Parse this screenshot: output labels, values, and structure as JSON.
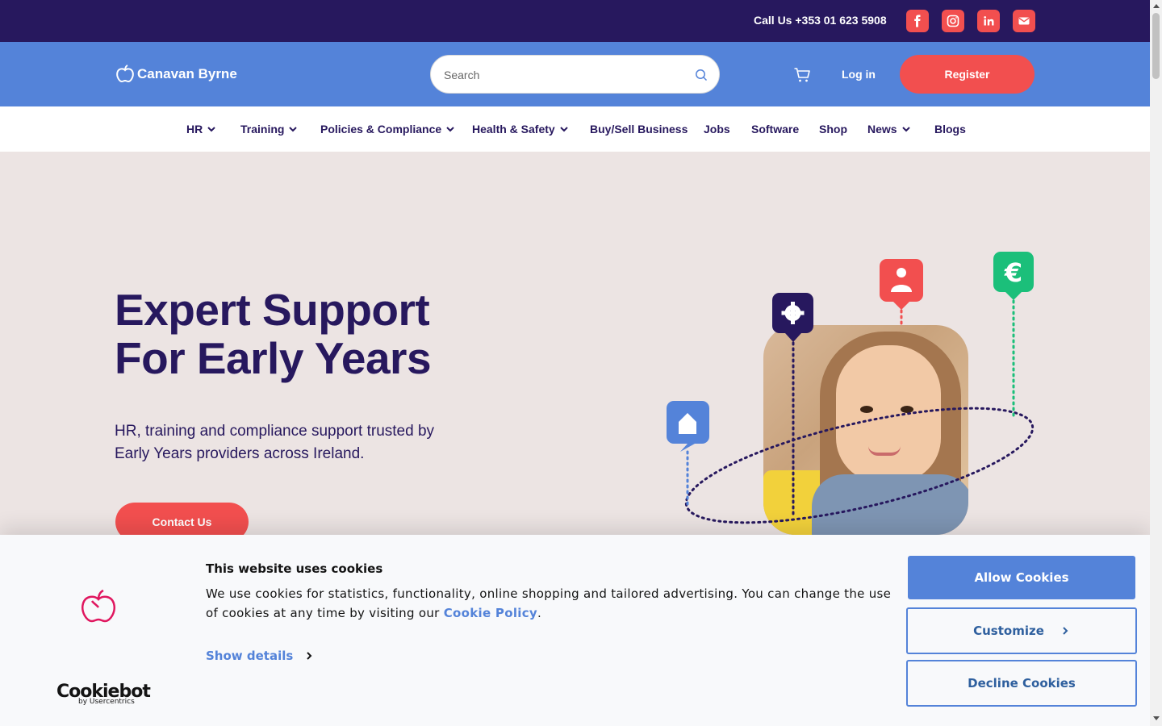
{
  "topbar": {
    "call_text": "Call Us +353 01 623 5908",
    "social": [
      {
        "icon": "facebook-icon"
      },
      {
        "icon": "instagram-icon"
      },
      {
        "icon": "linkedin-icon"
      },
      {
        "icon": "email-icon"
      }
    ]
  },
  "header": {
    "logo_text": "Canavan Byrne",
    "search_placeholder": "Search",
    "login_label": "Log in",
    "register_label": "Register"
  },
  "nav": {
    "items": [
      {
        "label": "HR",
        "dropdown": true
      },
      {
        "label": "Training",
        "dropdown": true
      },
      {
        "label": "Policies & Compliance",
        "dropdown": true
      },
      {
        "label": "Health & Safety",
        "dropdown": true
      },
      {
        "label": "Buy/Sell Business",
        "dropdown": false
      },
      {
        "label": "Jobs",
        "dropdown": false
      },
      {
        "label": "Software",
        "dropdown": false
      },
      {
        "label": "Shop",
        "dropdown": false
      },
      {
        "label": "News",
        "dropdown": true
      },
      {
        "label": "Blogs",
        "dropdown": false
      }
    ]
  },
  "hero": {
    "title_line1": "Expert Support",
    "title_line2": "For Early Years",
    "subtitle": "HR, training and compliance support trusted by Early Years providers across Ireland.",
    "cta_label": "Contact Us",
    "pins": [
      {
        "icon": "home-icon",
        "color": "#5483d9"
      },
      {
        "icon": "gear-icon",
        "color": "#27185e"
      },
      {
        "icon": "person-icon",
        "color": "#f24f4f"
      },
      {
        "icon": "euro-icon",
        "color": "#1bbf7a"
      }
    ]
  },
  "cookie": {
    "title": "This website uses cookies",
    "text_before": "We use cookies for statistics, functionality, online shopping and tailored advertising. You can change the use of cookies at any time by visiting our ",
    "link_text": "Cookie Policy",
    "text_after": ".",
    "show_details": "Show details",
    "allow_label": "Allow Cookies",
    "customize_label": "Customize",
    "decline_label": "Decline Cookies",
    "brand": "Cookiebot",
    "brand_by": "by Usercentrics"
  },
  "colors": {
    "navy": "#27185e",
    "blue": "#5483d9",
    "coral": "#f24f4f",
    "green": "#1bbf7a",
    "hero_bg": "#ece4e3"
  }
}
